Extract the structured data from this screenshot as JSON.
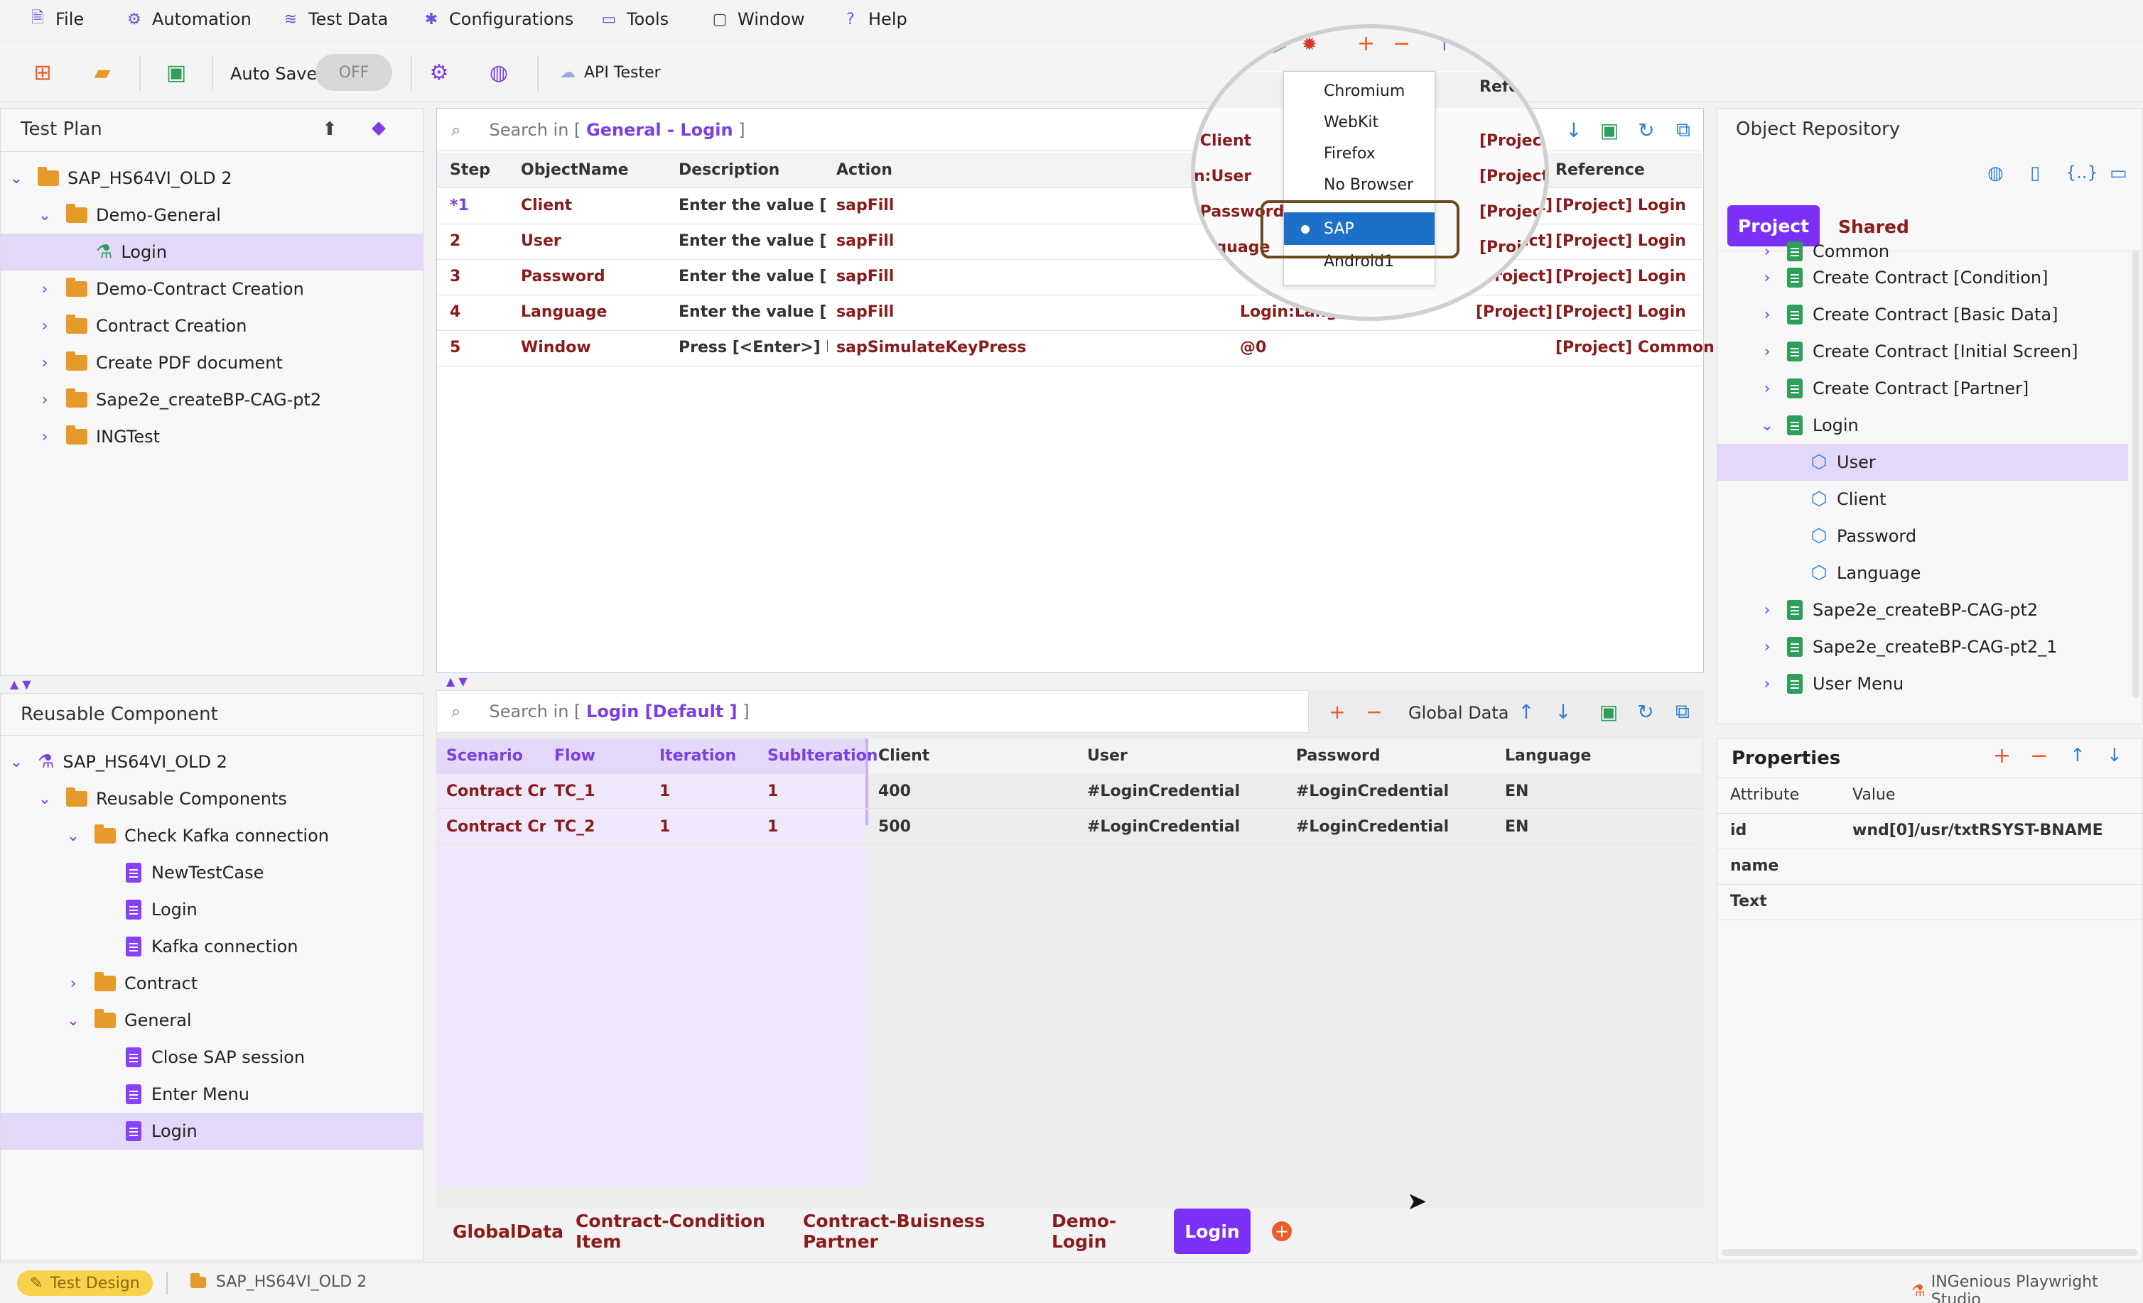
{
  "menu": [
    {
      "label": "File",
      "icon": "file-icon"
    },
    {
      "label": "Automation",
      "icon": "robot-icon"
    },
    {
      "label": "Test Data",
      "icon": "database-icon"
    },
    {
      "label": "Configurations",
      "icon": "gear-icon"
    },
    {
      "label": "Tools",
      "icon": "toolbox-icon"
    },
    {
      "label": "Window",
      "icon": "monitor-icon"
    },
    {
      "label": "Help",
      "icon": "help-icon"
    }
  ],
  "toolbar": {
    "auto_save_label": "Auto Save",
    "auto_save_state": "OFF",
    "api_tester_label": "API Tester"
  },
  "test_plan": {
    "title": "Test Plan",
    "items": [
      {
        "label": "SAP_HS64VI_OLD 2",
        "type": "folder",
        "expanded": true
      },
      {
        "label": "Demo-General",
        "type": "folder",
        "expanded": true
      },
      {
        "label": "Login",
        "type": "testcase",
        "selected": true
      },
      {
        "label": "Demo-Contract Creation",
        "type": "folder"
      },
      {
        "label": "Contract Creation",
        "type": "folder"
      },
      {
        "label": "Create PDF document",
        "type": "folder"
      },
      {
        "label": "Sape2e_createBP-CAG-pt2",
        "type": "folder"
      },
      {
        "label": "INGTest",
        "type": "folder"
      }
    ]
  },
  "steps_panel": {
    "search_prefix": "Search in [",
    "search_scope": "General - Login",
    "search_suffix": "]",
    "columns": [
      "Step",
      "ObjectName",
      "Description",
      "Action",
      "Reference"
    ],
    "rows": [
      {
        "step": "*1",
        "object": "Client",
        "description": "Enter the value [<...",
        "action": "sapFill",
        "input": ":Client",
        "condition": "[Project]",
        "reference": "[Project] Login"
      },
      {
        "step": "2",
        "object": "User",
        "description": "Enter the value [<...",
        "action": "sapFill",
        "input": "n:User",
        "condition": "[Project]",
        "reference": "[Project] Login"
      },
      {
        "step": "3",
        "object": "Password",
        "description": "Enter the value [<...",
        "action": "sapFill",
        "input": ":Password",
        "condition": "[Project]",
        "reference": "[Project] Login"
      },
      {
        "step": "4",
        "object": "Language",
        "description": "Enter the value [<...",
        "action": "sapFill",
        "input": "Login:Langu",
        "condition": "[Project]",
        "reference": "[Project] Login"
      },
      {
        "step": "5",
        "object": "Window",
        "description": "Press [<Enter>] key",
        "action": "sapSimulateKeyPress",
        "input": "@0",
        "condition": "",
        "reference": "[Project] Common"
      }
    ]
  },
  "browser_dropdown": {
    "header_partial": "Refere",
    "options": [
      "Chromium",
      "WebKit",
      "Firefox",
      "No Browser",
      "SAP",
      "Android1"
    ],
    "selected": "SAP",
    "magnified_cells": [
      ":Client",
      "n:User",
      ":Password",
      "anguage"
    ]
  },
  "object_repository": {
    "title": "Object Repository",
    "tabs": [
      "Project",
      "Shared"
    ],
    "active_tab": "Project",
    "items": [
      {
        "label": "Common",
        "type": "page",
        "level": 1
      },
      {
        "label": "Create Contract  [Condition]",
        "type": "page",
        "level": 1
      },
      {
        "label": "Create Contract [Basic Data]",
        "type": "page",
        "level": 1
      },
      {
        "label": "Create Contract [Initial Screen]",
        "type": "page",
        "level": 1
      },
      {
        "label": "Create Contract [Partner]",
        "type": "page",
        "level": 1
      },
      {
        "label": "Login",
        "type": "page",
        "level": 1,
        "expanded": true
      },
      {
        "label": "User",
        "type": "object",
        "level": 2,
        "selected": true
      },
      {
        "label": "Client",
        "type": "object",
        "level": 2
      },
      {
        "label": "Password",
        "type": "object",
        "level": 2
      },
      {
        "label": "Language",
        "type": "object",
        "level": 2
      },
      {
        "label": "Sape2e_createBP-CAG-pt2",
        "type": "page",
        "level": 1
      },
      {
        "label": "Sape2e_createBP-CAG-pt2_1",
        "type": "page",
        "level": 1
      },
      {
        "label": "User Menu",
        "type": "page",
        "level": 1
      }
    ]
  },
  "properties": {
    "title": "Properties",
    "columns": [
      "Attribute",
      "Value"
    ],
    "rows": [
      {
        "attribute": "id",
        "value": "wnd[0]/usr/txtRSYST-BNAME"
      },
      {
        "attribute": "name",
        "value": ""
      },
      {
        "attribute": "Text",
        "value": ""
      }
    ]
  },
  "reusable": {
    "title": "Reusable Component",
    "items": [
      {
        "label": "SAP_HS64VI_OLD 2",
        "type": "root"
      },
      {
        "label": "Reusable Components",
        "type": "folder"
      },
      {
        "label": "Check Kafka connection",
        "type": "folder"
      },
      {
        "label": "NewTestCase",
        "type": "component"
      },
      {
        "label": "Login",
        "type": "component"
      },
      {
        "label": "Kafka connection",
        "type": "component"
      },
      {
        "label": "Contract",
        "type": "folder"
      },
      {
        "label": "General",
        "type": "folder"
      },
      {
        "label": "Close SAP session",
        "type": "component"
      },
      {
        "label": "Enter Menu",
        "type": "component"
      },
      {
        "label": "Login",
        "type": "component",
        "selected": true
      }
    ]
  },
  "test_data": {
    "search_prefix": "Search in [",
    "search_scope": "Login [Default ]",
    "search_suffix": "]",
    "global_data_label": "Global Data",
    "columns": [
      "Scenario",
      "Flow",
      "Iteration",
      "SubIteration",
      "Client",
      "User",
      "Password",
      "Language"
    ],
    "rows": [
      [
        "Contract Cr...",
        "TC_1",
        "1",
        "1",
        "400",
        "#LoginCredential",
        "#LoginCredential",
        "EN"
      ],
      [
        "Contract Cr...",
        "TC_2",
        "1",
        "1",
        "500",
        "#LoginCredential",
        "#LoginCredential",
        "EN"
      ]
    ],
    "sheet_tabs": [
      "GlobalData",
      "Contract-Condition Item",
      "Contract-Buisness Partner",
      "Demo-Login",
      "Login"
    ],
    "active_sheet": "Login"
  },
  "status": {
    "mode": "Test Design",
    "project": "SAP_HS64VI_OLD 2",
    "app_name": "INGenious Playwright Studio"
  },
  "colors": {
    "accent": "#7b2ff7",
    "selection": "#e3d8f7",
    "action_red": "#8a1b1b",
    "dropdown_selected": "#1e6fc8"
  }
}
